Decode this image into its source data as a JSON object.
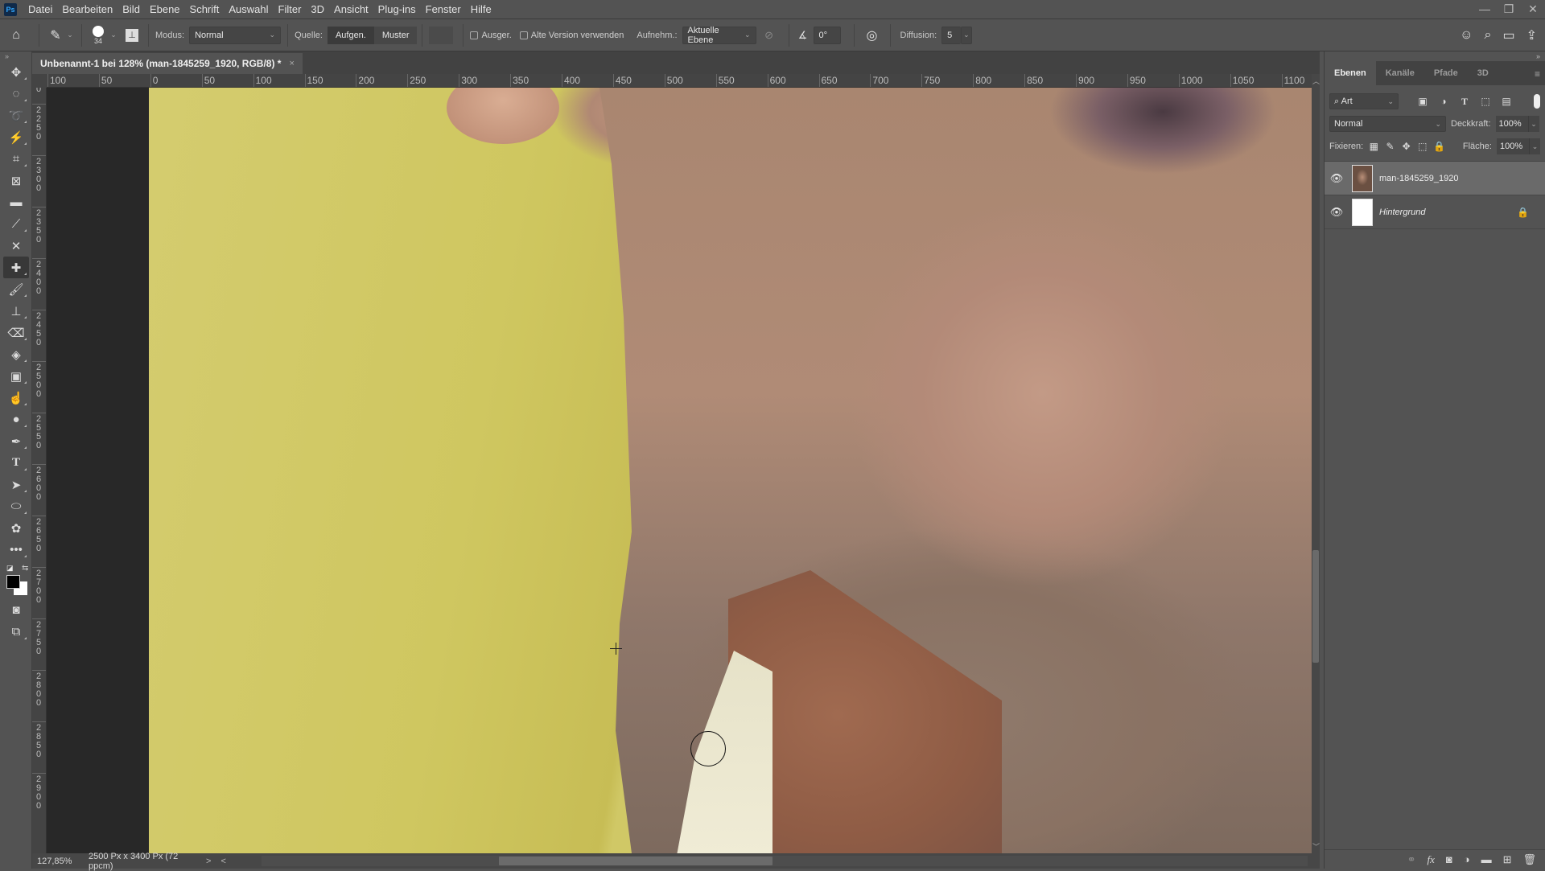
{
  "app": {
    "logo": "Ps"
  },
  "menu": [
    "Datei",
    "Bearbeiten",
    "Bild",
    "Ebene",
    "Schrift",
    "Auswahl",
    "Filter",
    "3D",
    "Ansicht",
    "Plug-ins",
    "Fenster",
    "Hilfe"
  ],
  "window_controls": {
    "minimize": "—",
    "restore": "❐",
    "close": "✕"
  },
  "options": {
    "brush_size": "34",
    "modus_label": "Modus:",
    "modus_value": "Normal",
    "quelle_label": "Quelle:",
    "source_aufgen": "Aufgen.",
    "source_muster": "Muster",
    "ausger_label": "Ausger.",
    "alte_version_label": "Alte Version verwenden",
    "aufnehm_label": "Aufnehm.:",
    "aufnehm_value": "Aktuelle Ebene",
    "angle_value": "0°",
    "diffusion_label": "Diffusion:",
    "diffusion_value": "5"
  },
  "document": {
    "tab_title": "Unbenannt-1 bei 128% (man-1845259_1920, RGB/8) *",
    "close": "×"
  },
  "ruler_h": [
    "100",
    "50",
    "0",
    "50",
    "100",
    "150",
    "200",
    "250",
    "300",
    "350",
    "400",
    "450",
    "500",
    "550",
    "600",
    "650",
    "700",
    "750",
    "800",
    "850",
    "900",
    "950",
    "1000",
    "1050",
    "1100"
  ],
  "ruler_v": [
    "0",
    "2250",
    "2300",
    "2350",
    "2400",
    "2450",
    "2500",
    "2550",
    "2600",
    "2650",
    "2700",
    "2750",
    "2800",
    "2850",
    "2900"
  ],
  "status": {
    "zoom": "127,85%",
    "doc_info": "2500 Px x 3400 Px (72 ppcm)",
    "next_arrow": ">",
    "prev_arrow": "<"
  },
  "layers_panel": {
    "tabs": [
      {
        "label": "Ebenen",
        "active": true
      },
      {
        "label": "Kanäle",
        "active": false
      },
      {
        "label": "Pfade",
        "active": false
      },
      {
        "label": "3D",
        "active": false
      }
    ],
    "filter_value": "Art",
    "blend_mode": "Normal",
    "opacity_label": "Deckkraft:",
    "opacity_value": "100%",
    "lock_label": "Fixieren:",
    "fill_label": "Fläche:",
    "fill_value": "100%",
    "layers": [
      {
        "name": "man-1845259_1920",
        "selected": true,
        "visible": true,
        "locked": false
      },
      {
        "name": "Hintergrund",
        "selected": false,
        "visible": true,
        "locked": true
      }
    ]
  }
}
